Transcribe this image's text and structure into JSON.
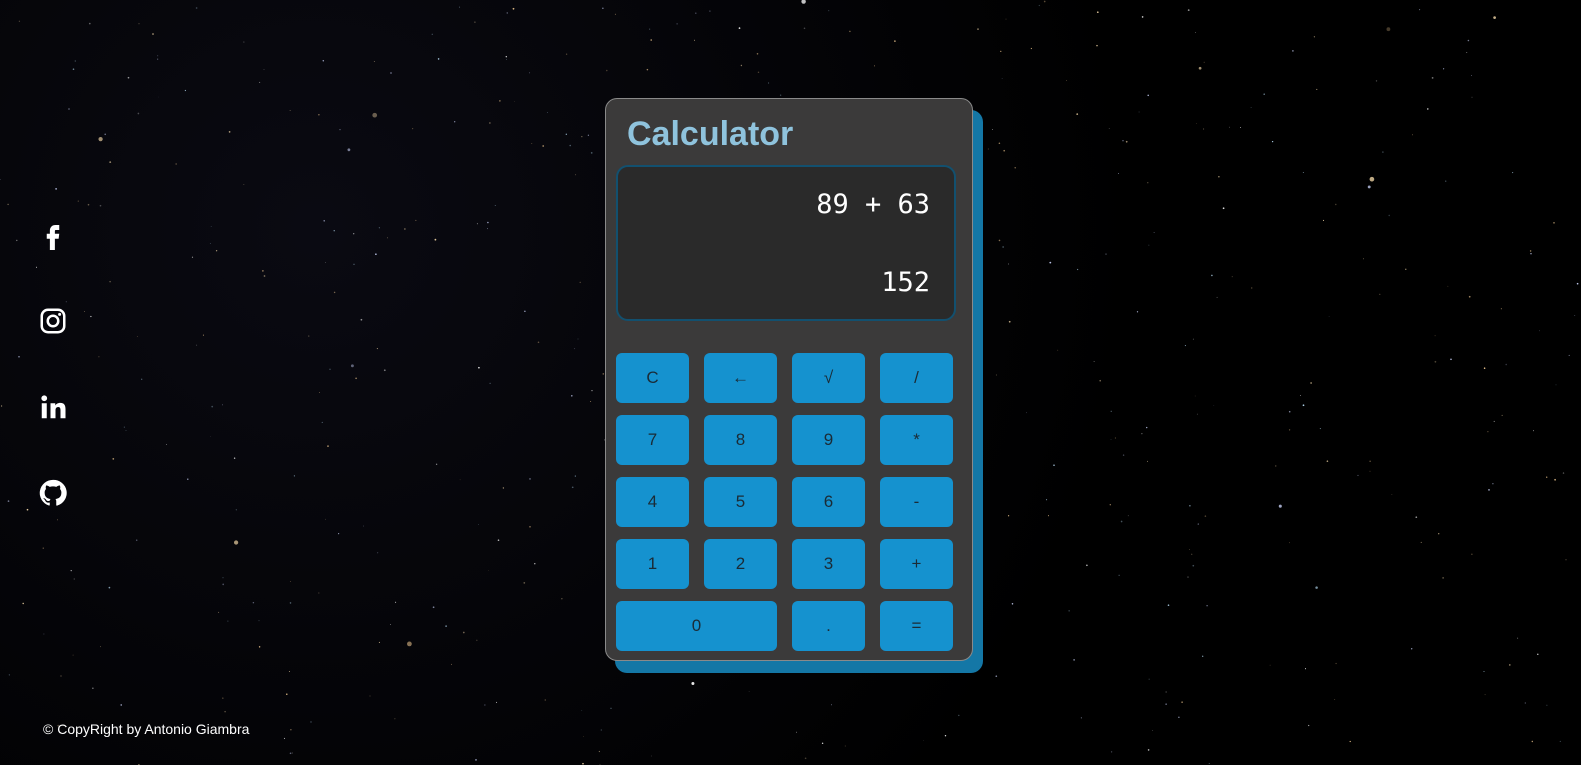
{
  "social": [
    {
      "name": "facebook-icon"
    },
    {
      "name": "instagram-icon"
    },
    {
      "name": "linkedin-icon"
    },
    {
      "name": "github-icon"
    }
  ],
  "calculator": {
    "title": "Calculator",
    "expression": "89 + 63",
    "result": "152",
    "keys": [
      {
        "label": "C"
      },
      {
        "label": "←"
      },
      {
        "label": "√"
      },
      {
        "label": "/"
      },
      {
        "label": "7"
      },
      {
        "label": "8"
      },
      {
        "label": "9"
      },
      {
        "label": "*"
      },
      {
        "label": "4"
      },
      {
        "label": "5"
      },
      {
        "label": "6"
      },
      {
        "label": "-"
      },
      {
        "label": "1"
      },
      {
        "label": "2"
      },
      {
        "label": "3"
      },
      {
        "label": "+"
      },
      {
        "label": "0"
      },
      {
        "label": "."
      },
      {
        "label": "="
      }
    ]
  },
  "footer": {
    "text": "© CopyRight by Antonio Giambra"
  },
  "colors": {
    "background": "#000000",
    "calculator_body": "#3b3a3a",
    "display": "#2a2a2a",
    "key": "#1592cf",
    "accent_shadow": "#1477a6",
    "title": "#8fc3dd"
  }
}
